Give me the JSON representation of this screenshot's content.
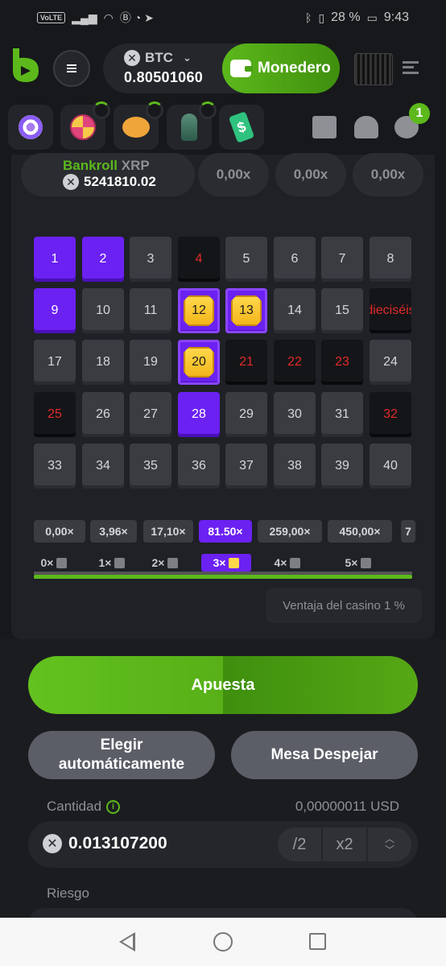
{
  "status": {
    "volte": "VoLTE",
    "battery": "28 %",
    "time": "9:43"
  },
  "header": {
    "coin": "BTC",
    "balance": "0.80501060",
    "wallet_label": "Monedero"
  },
  "notifications_count": "1",
  "panel": {
    "bankroll_label": "Bankroll",
    "bankroll_coin": "XRP",
    "bankroll_value": "5241810.02",
    "multipliers": [
      "0,00x",
      "0,00x",
      "0,00x"
    ]
  },
  "grid": [
    {
      "label": "1",
      "state": "selected"
    },
    {
      "label": "2",
      "state": "selected"
    },
    {
      "label": "3",
      "state": "normal"
    },
    {
      "label": "4",
      "state": "red"
    },
    {
      "label": "5",
      "state": "normal"
    },
    {
      "label": "6",
      "state": "normal"
    },
    {
      "label": "7",
      "state": "normal"
    },
    {
      "label": "8",
      "state": "normal"
    },
    {
      "label": "9",
      "state": "selected"
    },
    {
      "label": "10",
      "state": "normal"
    },
    {
      "label": "11",
      "state": "normal"
    },
    {
      "label": "12",
      "state": "hit"
    },
    {
      "label": "13",
      "state": "hit"
    },
    {
      "label": "14",
      "state": "normal"
    },
    {
      "label": "15",
      "state": "normal"
    },
    {
      "label": "dieciséis",
      "state": "red"
    },
    {
      "label": "17",
      "state": "normal"
    },
    {
      "label": "18",
      "state": "normal"
    },
    {
      "label": "19",
      "state": "normal"
    },
    {
      "label": "20",
      "state": "hit"
    },
    {
      "label": "21",
      "state": "red"
    },
    {
      "label": "22",
      "state": "red"
    },
    {
      "label": "23",
      "state": "red"
    },
    {
      "label": "24",
      "state": "normal"
    },
    {
      "label": "25",
      "state": "red"
    },
    {
      "label": "26",
      "state": "normal"
    },
    {
      "label": "27",
      "state": "normal"
    },
    {
      "label": "28",
      "state": "selected"
    },
    {
      "label": "29",
      "state": "normal"
    },
    {
      "label": "30",
      "state": "normal"
    },
    {
      "label": "31",
      "state": "normal"
    },
    {
      "label": "32",
      "state": "red"
    },
    {
      "label": "33",
      "state": "normal"
    },
    {
      "label": "34",
      "state": "normal"
    },
    {
      "label": "35",
      "state": "normal"
    },
    {
      "label": "36",
      "state": "normal"
    },
    {
      "label": "37",
      "state": "normal"
    },
    {
      "label": "38",
      "state": "normal"
    },
    {
      "label": "39",
      "state": "normal"
    },
    {
      "label": "40",
      "state": "normal"
    }
  ],
  "payouts": [
    {
      "label": "0,00×",
      "selected": false
    },
    {
      "label": "3,96×",
      "selected": false
    },
    {
      "label": "17,10×",
      "selected": false
    },
    {
      "label": "81.50×",
      "selected": true
    },
    {
      "label": "259,00×",
      "selected": false
    },
    {
      "label": "450,00×",
      "selected": false
    },
    {
      "label": "7",
      "selected": false
    }
  ],
  "hits": [
    {
      "label": "0×",
      "selected": false
    },
    {
      "label": "1×",
      "selected": false
    },
    {
      "label": "2×",
      "selected": false
    },
    {
      "label": "3×",
      "selected": true
    },
    {
      "label": "4×",
      "selected": false
    },
    {
      "label": "5×",
      "selected": false
    }
  ],
  "house_edge": "Ventaja del casino 1 %",
  "controls": {
    "bet_label": "Apuesta",
    "auto_label": "Elegir automáticamente",
    "clear_label": "Mesa Despejar",
    "amount_label": "Cantidad",
    "usd_value": "0,00000011 USD",
    "amount_value": "0.013107200",
    "half_label": "/2",
    "double_label": "x2",
    "risk_label": "Riesgo"
  },
  "colors": {
    "accent": "#5cb81b",
    "selected": "#6b21f2",
    "gem": "#ffd84a",
    "loss": "#e12a2a"
  }
}
